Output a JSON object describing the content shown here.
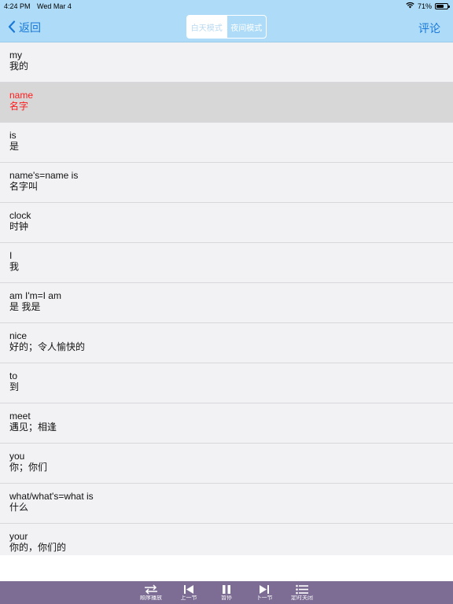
{
  "status": {
    "time": "4:24 PM",
    "date": "Wed Mar 4",
    "battery": "71%",
    "battery_level": 0.71
  },
  "nav": {
    "back_label": "返回",
    "day_mode": "白天模式",
    "night_mode": "夜间模式",
    "comment_label": "评论"
  },
  "words": [
    {
      "en": "my",
      "zh": "我的"
    },
    {
      "en": "name",
      "zh": "名字"
    },
    {
      "en": "is",
      "zh": "是"
    },
    {
      "en": "name's=name is",
      "zh": "名字叫"
    },
    {
      "en": "clock",
      "zh": "时钟"
    },
    {
      "en": "I",
      "zh": "我"
    },
    {
      "en": "am I'm=I am",
      "zh": "是 我是"
    },
    {
      "en": "nice",
      "zh": "好的；令人愉快的"
    },
    {
      "en": "to",
      "zh": "到"
    },
    {
      "en": "meet",
      "zh": "遇见；相逢"
    },
    {
      "en": "you",
      "zh": "你；你们"
    },
    {
      "en": "what/what's=what is",
      "zh": "什么"
    },
    {
      "en": "your",
      "zh": "你的，你们的"
    }
  ],
  "player": {
    "order_label": "顺序播放",
    "prev_label": "上一节",
    "pause_label": "暂停",
    "next_label": "下一节",
    "timer_label": "定时关闭"
  },
  "colors": {
    "nav_bg": "#aedcf8",
    "accent": "#1a79d8",
    "highlight_text": "#ff1a1a",
    "player_bg": "#7d6d94"
  }
}
